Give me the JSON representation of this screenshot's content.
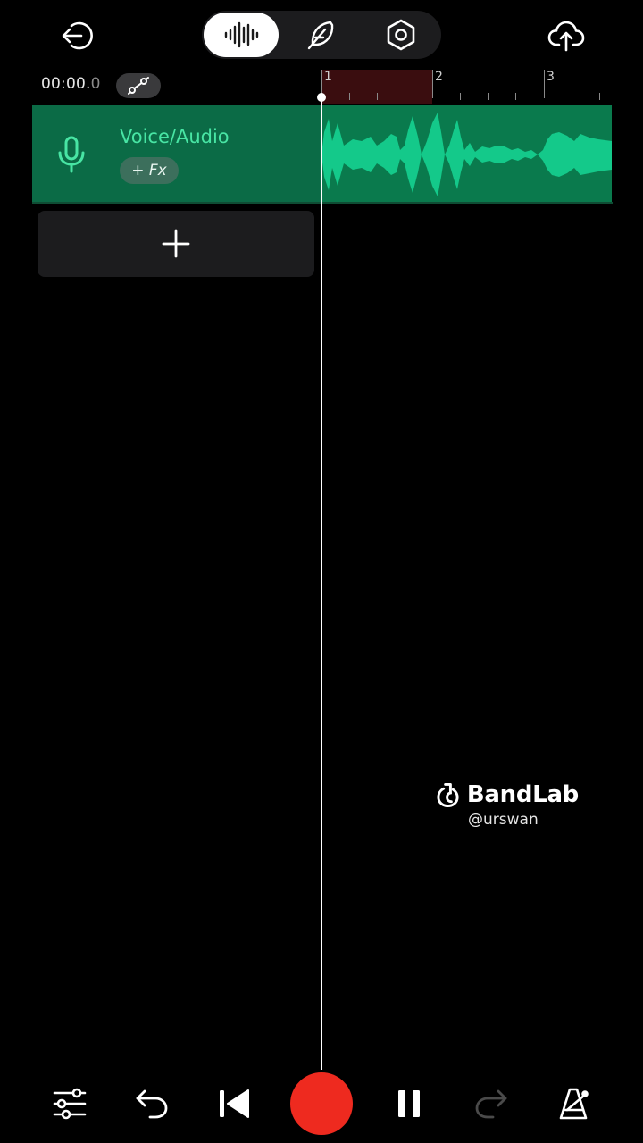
{
  "header": {
    "modes": [
      {
        "icon": "waveform-icon",
        "selected": true
      },
      {
        "icon": "feather-icon",
        "selected": false
      },
      {
        "icon": "gear-icon",
        "selected": false
      }
    ]
  },
  "timecode": {
    "main": "00:00.",
    "fraction": "0"
  },
  "ruler": {
    "bars": [
      "1",
      "2",
      "3"
    ]
  },
  "track": {
    "name": "Voice/Audio",
    "fx_label": "+ Fx",
    "color": "#0a7a4d",
    "wave_color": "#14c98a"
  },
  "watermark": {
    "brand": "BandLab",
    "user": "@urswan"
  },
  "transport": {
    "record_color": "#ee2a1f",
    "redo_enabled": false
  }
}
